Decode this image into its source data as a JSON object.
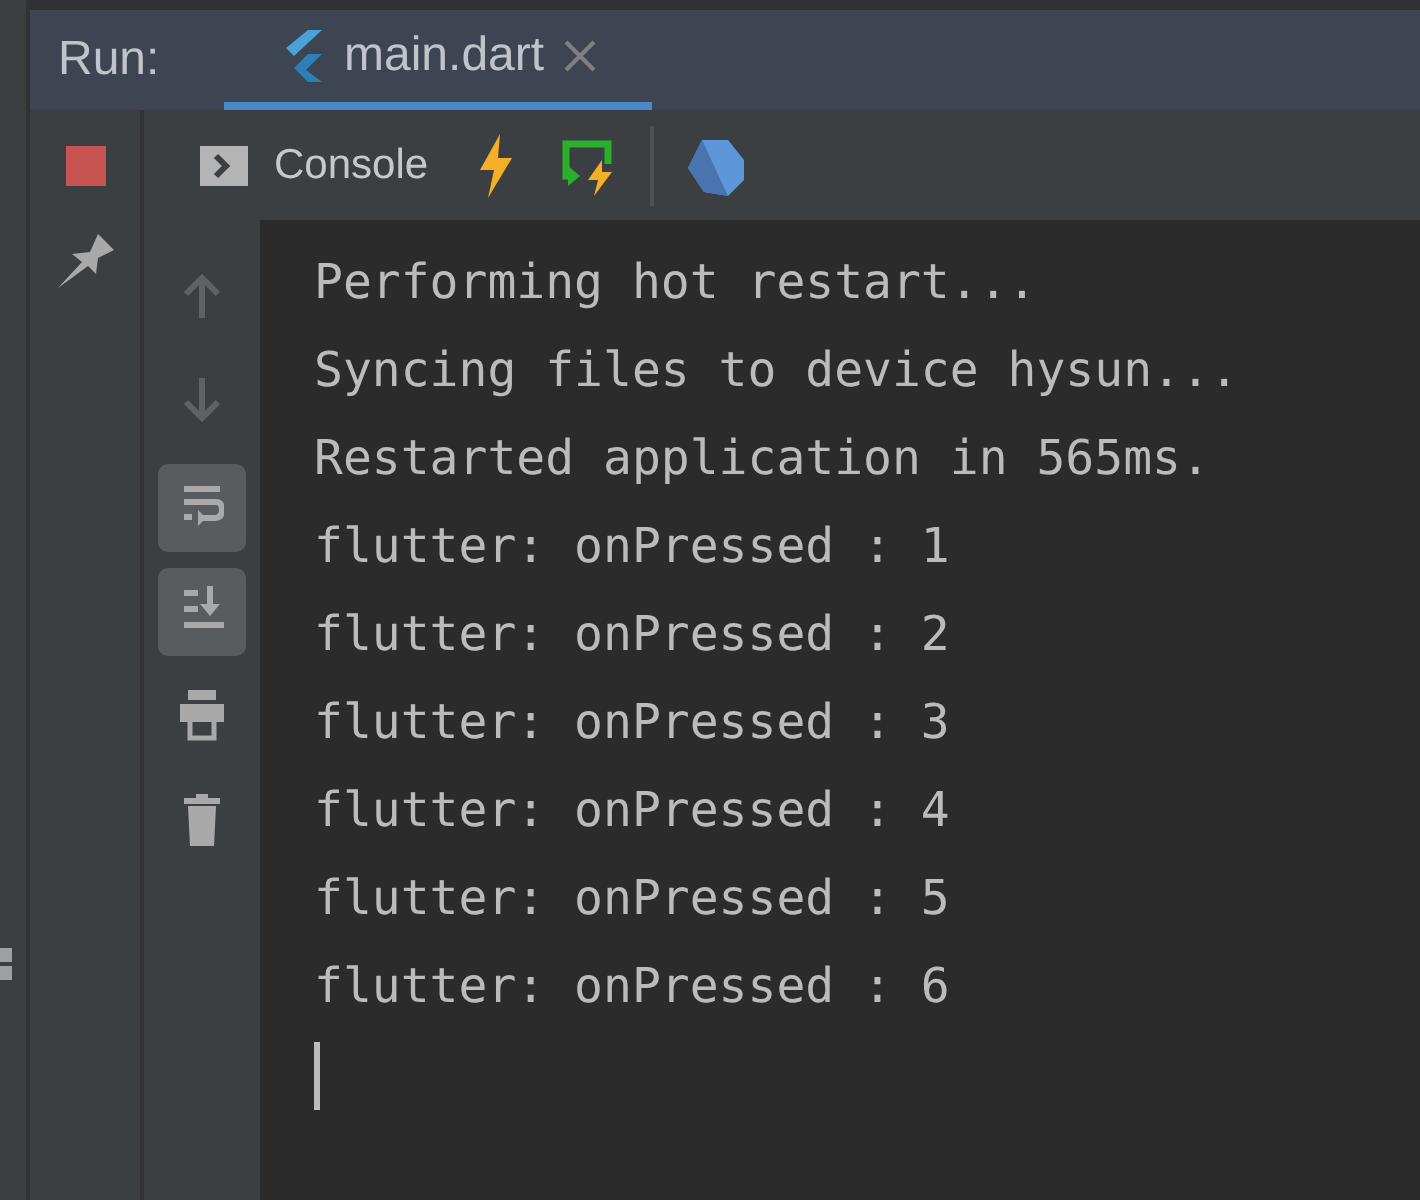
{
  "run_label": "Run:",
  "tabs": [
    {
      "label": "main.dart",
      "selected": true
    }
  ],
  "toolbar": {
    "console_label": "Console"
  },
  "side_tools": [
    {
      "kind": "up",
      "disabled": true
    },
    {
      "kind": "down",
      "disabled": true
    },
    {
      "kind": "wrap",
      "selected": true
    },
    {
      "kind": "scroll-end",
      "selected": true
    },
    {
      "kind": "print"
    },
    {
      "kind": "trash"
    }
  ],
  "console_lines": [
    "Performing hot restart...",
    "Syncing files to device hysun...",
    "Restarted application in 565ms.",
    "flutter: onPressed : 1",
    "flutter: onPressed : 2",
    "flutter: onPressed : 3",
    "flutter: onPressed : 4",
    "flutter: onPressed : 5",
    "flutter: onPressed : 6"
  ]
}
